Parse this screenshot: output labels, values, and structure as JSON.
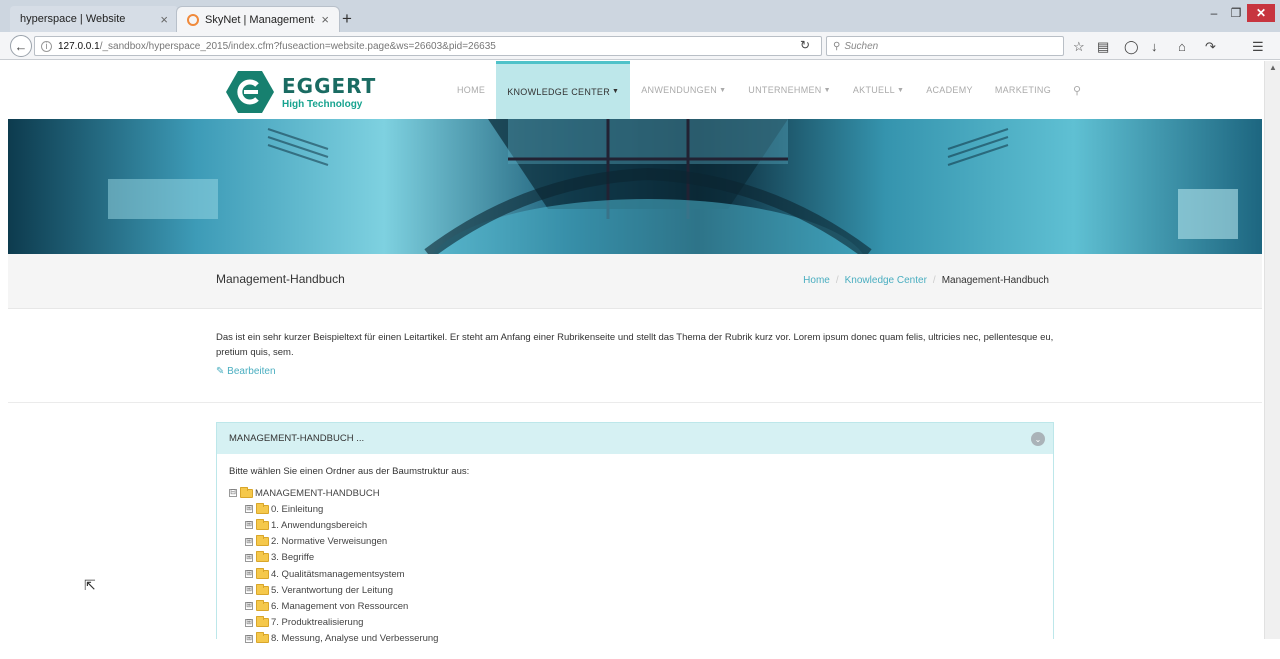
{
  "browser": {
    "tabs": [
      {
        "title": "hyperspace | Website",
        "close": "×"
      },
      {
        "title": "SkyNet | Management-Ha...",
        "close": "×"
      }
    ],
    "new_tab": "+",
    "window_controls": {
      "minimize": "–",
      "maximize": "❐",
      "close": "✕"
    },
    "url_host": "127.0.0.1",
    "url_path": "/_sandbox/hyperspace_2015/index.cfm?fuseaction=website.page&ws=26603&pid=26635",
    "search_placeholder": "Suchen",
    "icons": [
      "star-icon",
      "clipboard-icon",
      "pocket-icon",
      "download-icon",
      "home-icon",
      "share-icon",
      "menu-icon"
    ]
  },
  "site": {
    "logo": {
      "name": "EGGERT",
      "sub": "High Technology"
    },
    "menu": [
      {
        "label": "HOME",
        "caret": false,
        "active": false
      },
      {
        "label": "KNOWLEDGE CENTER",
        "caret": true,
        "active": true
      },
      {
        "label": "ANWENDUNGEN",
        "caret": true,
        "active": false
      },
      {
        "label": "UNTERNEHMEN",
        "caret": true,
        "active": false
      },
      {
        "label": "AKTUELL",
        "caret": true,
        "active": false
      },
      {
        "label": "ACADEMY",
        "caret": false,
        "active": false
      },
      {
        "label": "MARKETING",
        "caret": false,
        "active": false
      }
    ],
    "page_title": "Management-Handbuch",
    "breadcrumb": {
      "home": "Home",
      "section": "Knowledge Center",
      "current": "Management-Handbuch",
      "sep": "/"
    },
    "intro": "Das ist ein sehr kurzer Beispieltext für einen Leitartikel. Er steht am Anfang einer Rubrikenseite und stellt das Thema der Rubrik kurz vor. Lorem ipsum donec quam felis, ultricies nec, pellentesque eu, pretium quis, sem.",
    "edit_label": "Bearbeiten",
    "panel": {
      "title": "MANAGEMENT-HANDBUCH ...",
      "instruction": "Bitte wählen Sie einen Ordner aus der Baumstruktur aus:",
      "root": "MANAGEMENT-HANDBUCH",
      "items": [
        "0. Einleitung",
        "1. Anwendungsbereich",
        "2. Normative Verweisungen",
        "3. Begriffe",
        "4. Qualitätsmanagementsystem",
        "5. Verantwortung der Leitung",
        "6. Management von Ressourcen",
        "7. Produktrealisierung",
        "8. Messung, Analyse und Verbesserung"
      ]
    }
  }
}
